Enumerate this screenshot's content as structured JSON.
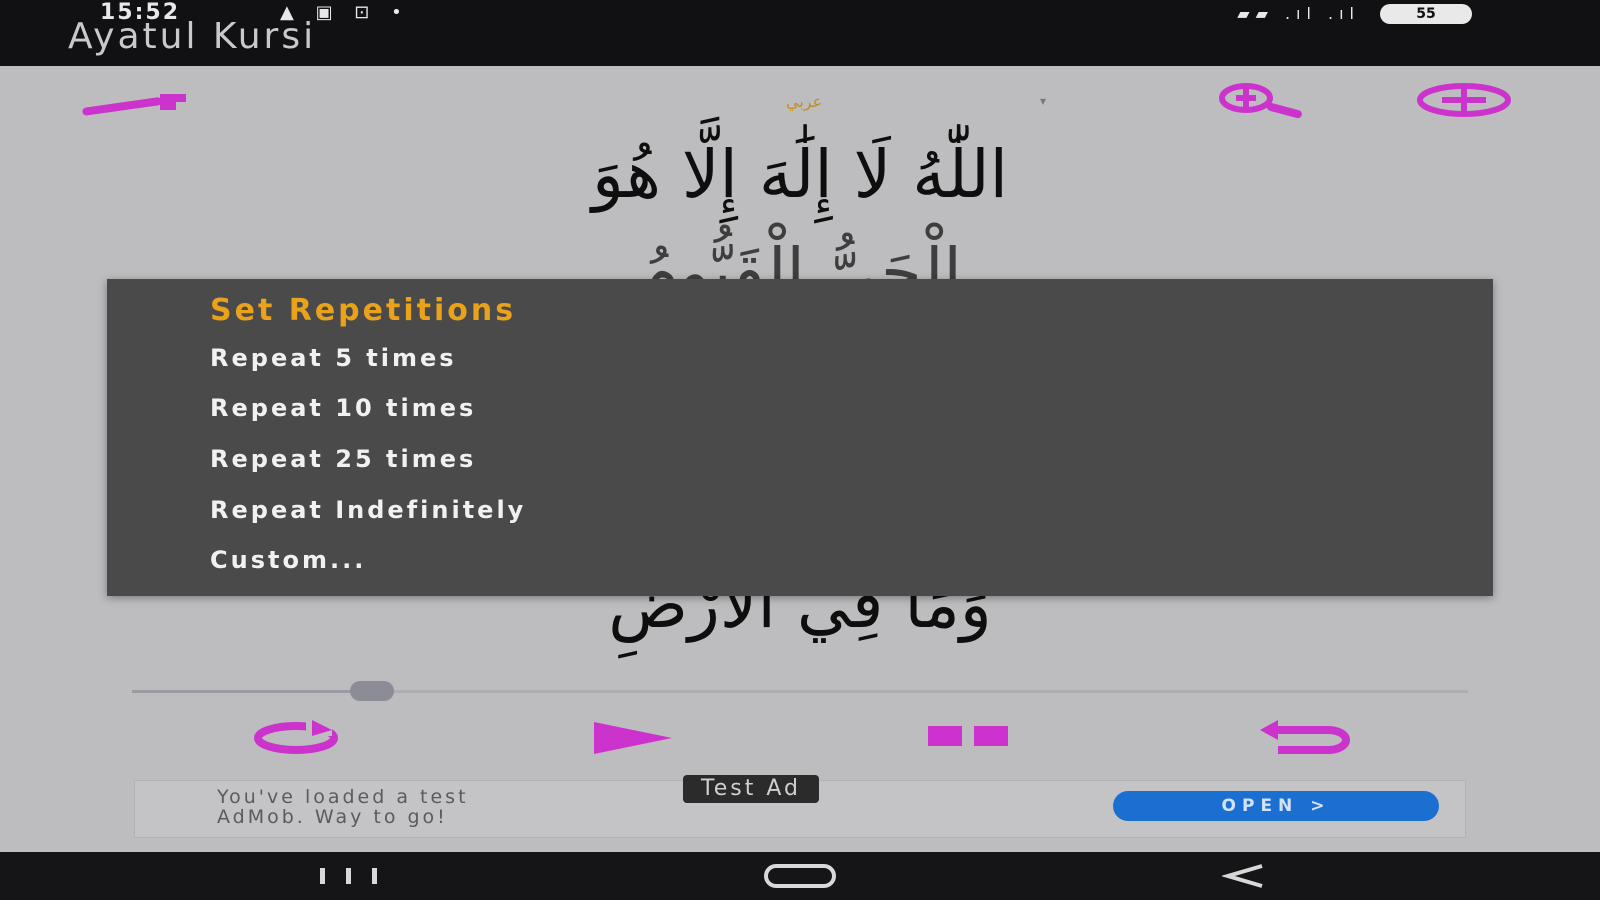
{
  "status_bar": {
    "time": "15:52",
    "left_icons": "▲ ▣ ⊡ •",
    "right_icons": "▰▰ .ıl .ıl",
    "battery": "55"
  },
  "app": {
    "title": "Ayatul Kursi",
    "accent_color": "#cc33cc",
    "language_label": "عربي",
    "language_caret": "▾"
  },
  "verse": {
    "line1": "اللّٰهُ لَا إِلَٰهَ إِلَّا هُوَ",
    "line2": "الْحَيُّ الْقَيُّومُ",
    "line3": "وَمَا فِي الْأَرْضِ"
  },
  "player": {
    "progress": 0.18
  },
  "dialog": {
    "title": "Set Repetitions",
    "options": [
      "Repeat 5 times",
      "Repeat 10 times",
      "Repeat 25 times",
      "Repeat Indefinitely",
      "Custom..."
    ]
  },
  "ad": {
    "text_line1": "You've loaded a test",
    "text_line2": "AdMob. Way to go!",
    "badge": "Test Ad",
    "open_label": "OPEN  >"
  }
}
